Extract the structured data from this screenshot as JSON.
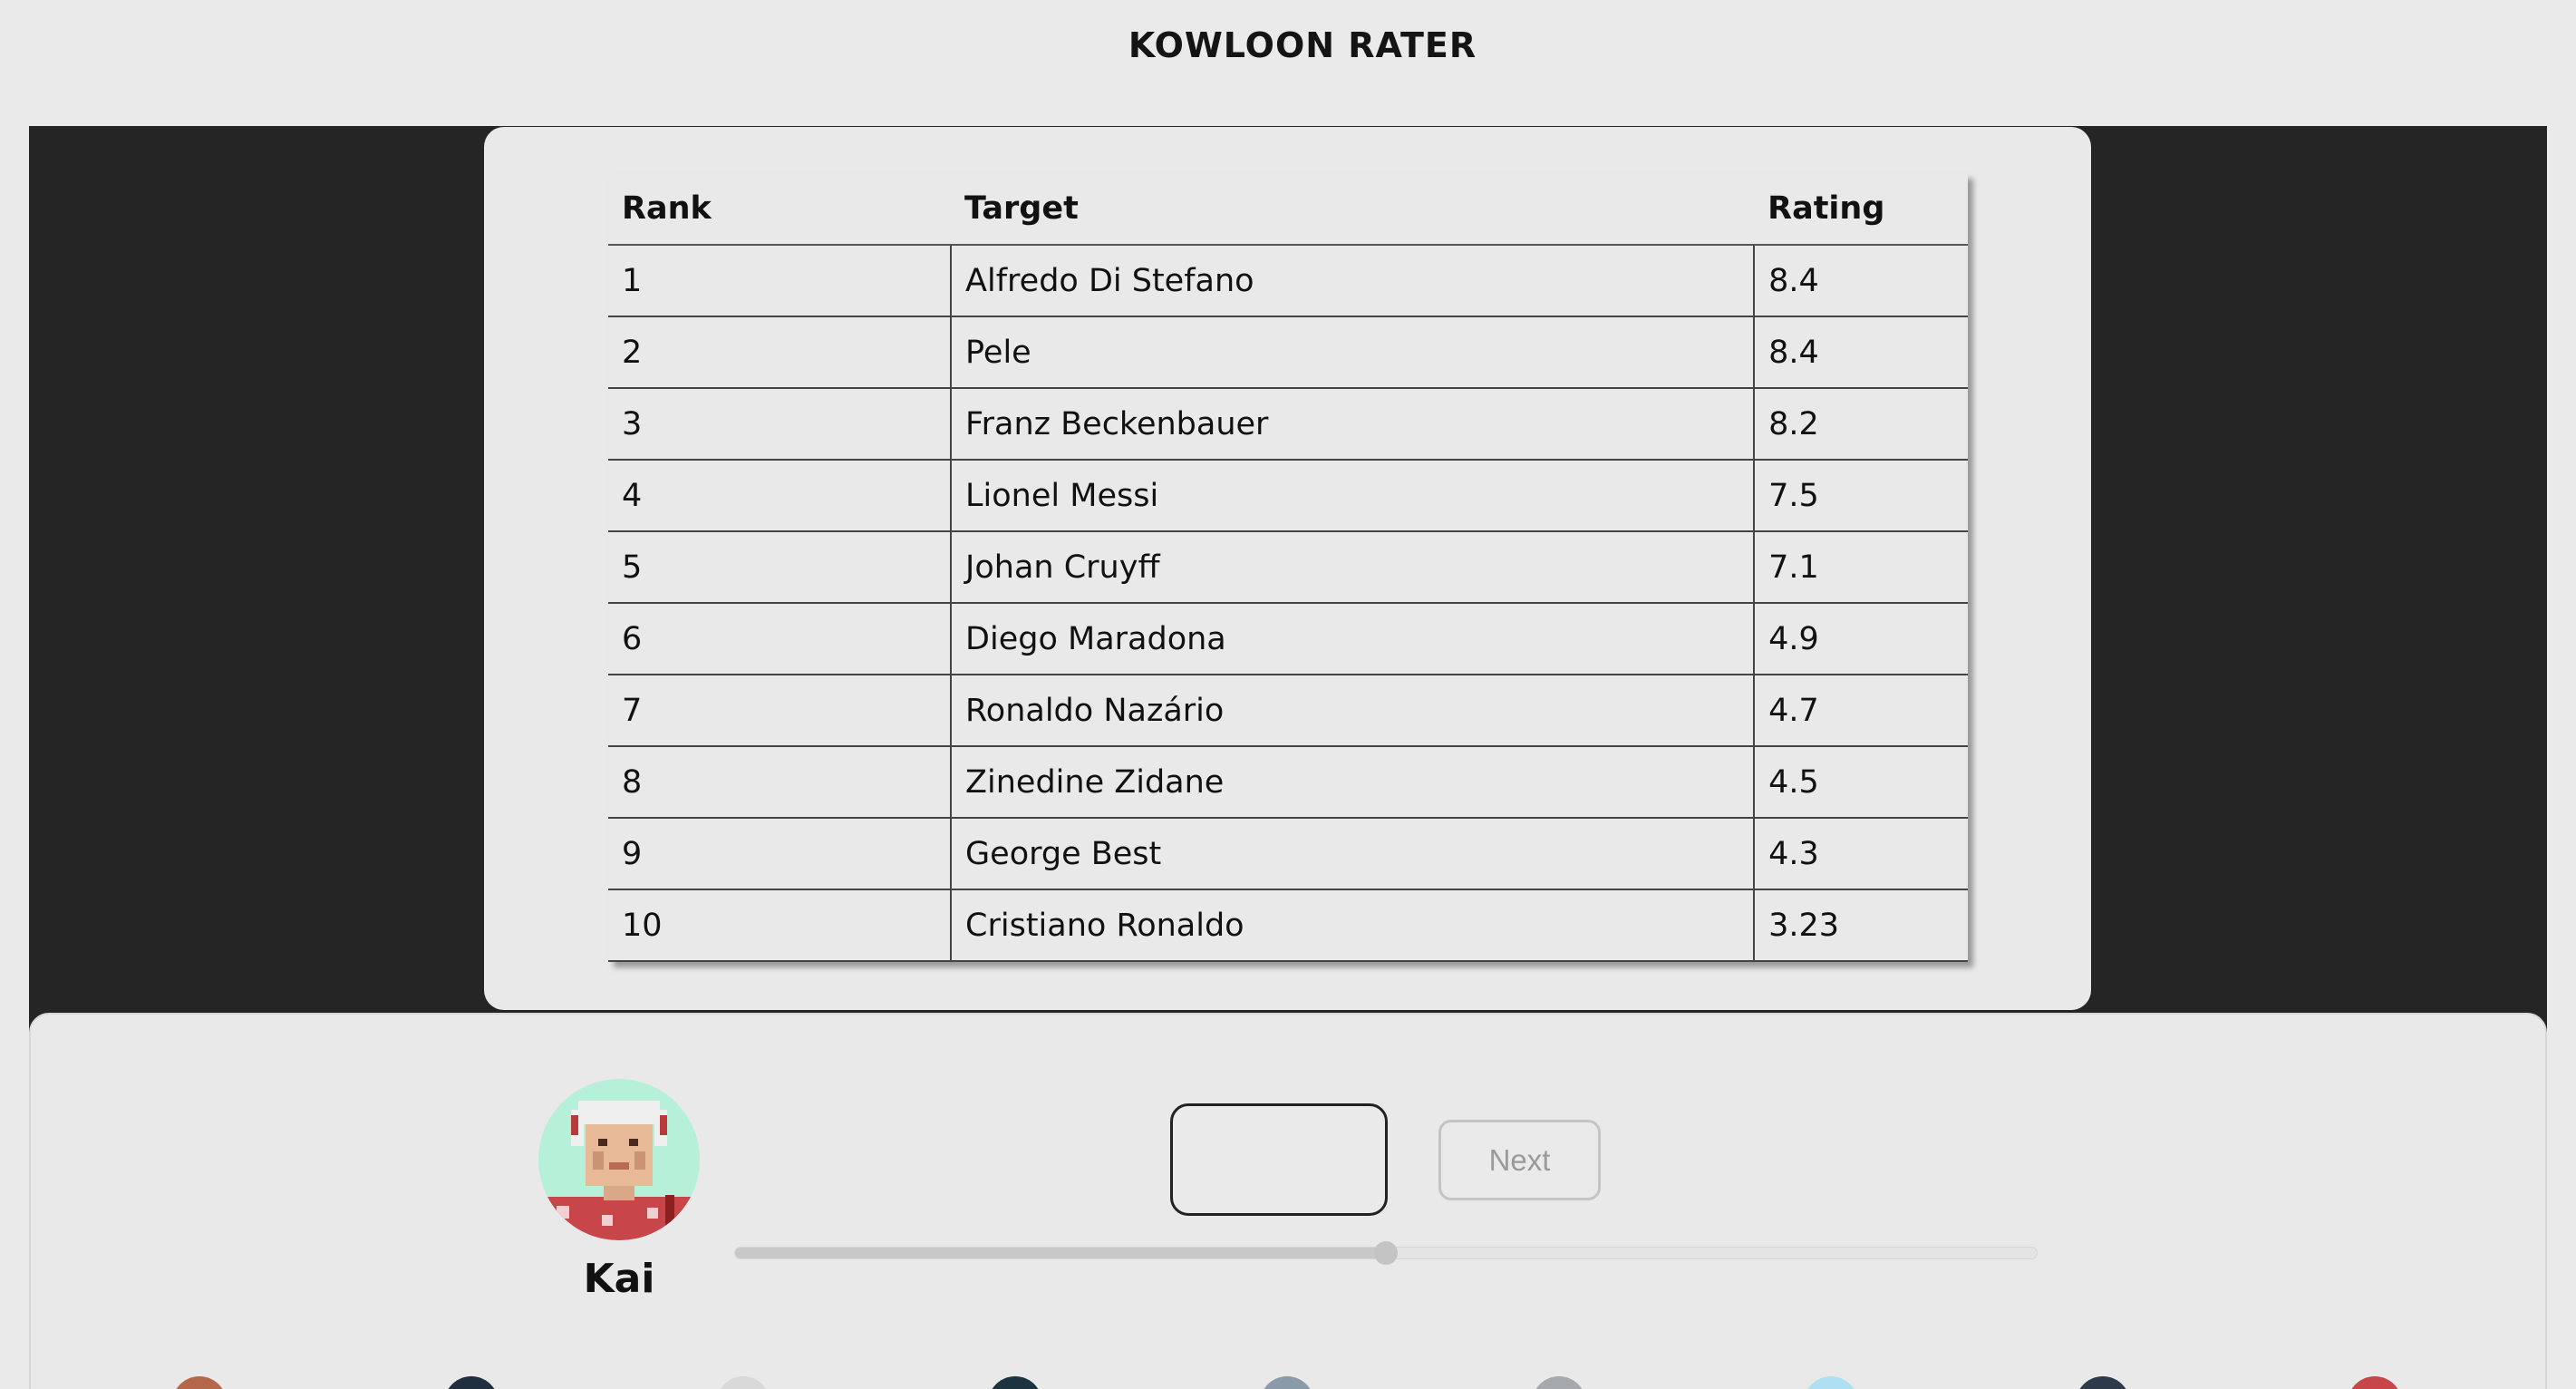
{
  "app": {
    "title": "KOWLOON RATER"
  },
  "table": {
    "headers": {
      "rank": "Rank",
      "target": "Target",
      "rating": "Rating"
    },
    "rows": [
      {
        "rank": "1",
        "target": "Alfredo Di Stefano",
        "rating": "8.4"
      },
      {
        "rank": "2",
        "target": "Pele",
        "rating": "8.4"
      },
      {
        "rank": "3",
        "target": "Franz Beckenbauer",
        "rating": "8.2"
      },
      {
        "rank": "4",
        "target": "Lionel Messi",
        "rating": "7.5"
      },
      {
        "rank": "5",
        "target": "Johan Cruyff",
        "rating": "7.1"
      },
      {
        "rank": "6",
        "target": "Diego Maradona",
        "rating": "4.9"
      },
      {
        "rank": "7",
        "target": "Ronaldo Nazário",
        "rating": "4.7"
      },
      {
        "rank": "8",
        "target": "Zinedine Zidane",
        "rating": "4.5"
      },
      {
        "rank": "9",
        "target": "George Best",
        "rating": "4.3"
      },
      {
        "rank": "10",
        "target": "Cristiano Ronaldo",
        "rating": "3.23"
      }
    ]
  },
  "rater": {
    "user_name": "Kai",
    "avatar_icon": "pixel-avatar-icon",
    "rating_input_value": "",
    "next_label": "Next",
    "slider_fraction": 0.5
  },
  "player_avatars": [
    {
      "color": "#b5674b"
    },
    {
      "color": "#1f2f3f"
    },
    {
      "color": "#d9d9d9"
    },
    {
      "color": "#1c3440"
    },
    {
      "color": "#8a9aa8"
    },
    {
      "color": "#a5a9ad"
    },
    {
      "color": "#aee0f2"
    },
    {
      "color": "#2c3a4a"
    },
    {
      "color": "#c8454a"
    }
  ],
  "colors": {
    "page_bg": "#eaeaea",
    "band_bg": "#252525",
    "avatar_bg": "#b7f0d9"
  }
}
